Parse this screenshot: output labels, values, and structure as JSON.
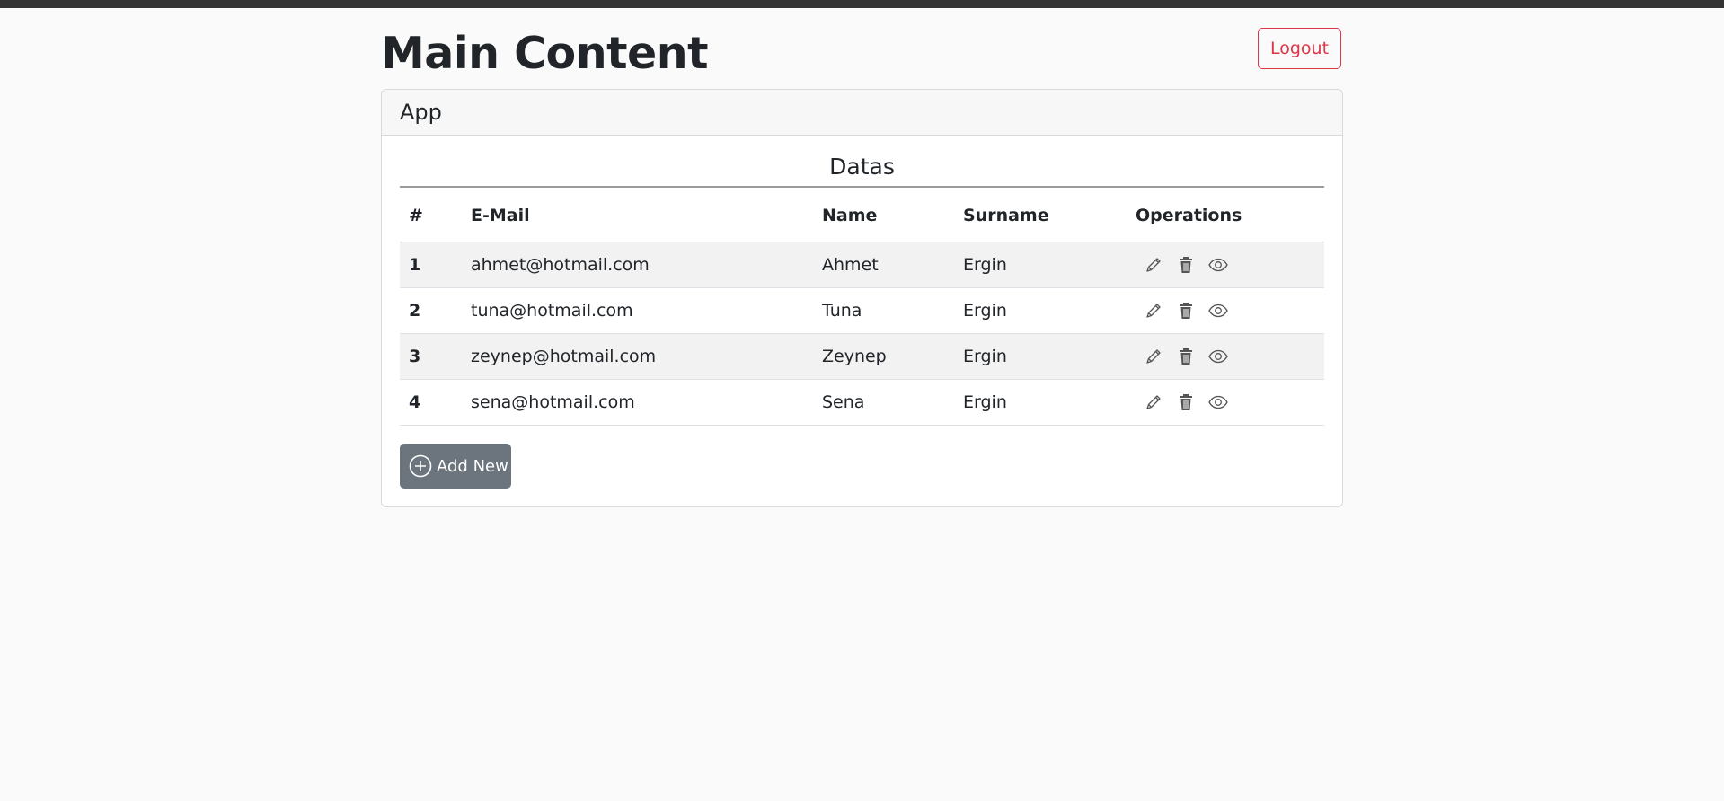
{
  "header": {
    "title": "Main Content",
    "logout_label": "Logout"
  },
  "card": {
    "title": "App",
    "table_caption": "Datas",
    "columns": [
      "#",
      "E-Mail",
      "Name",
      "Surname",
      "Operations"
    ],
    "rows": [
      {
        "id": "1",
        "email": "ahmet@hotmail.com",
        "name": "Ahmet",
        "surname": "Ergin"
      },
      {
        "id": "2",
        "email": "tuna@hotmail.com",
        "name": "Tuna",
        "surname": "Ergin"
      },
      {
        "id": "3",
        "email": "zeynep@hotmail.com",
        "name": "Zeynep",
        "surname": "Ergin"
      },
      {
        "id": "4",
        "email": "sena@hotmail.com",
        "name": "Sena",
        "surname": "Ergin"
      }
    ],
    "row_actions": [
      "pencil-icon",
      "trash-icon",
      "eye-icon"
    ],
    "add_label": "Add New"
  },
  "colors": {
    "danger": "#dc3545",
    "secondary": "#6c757d",
    "topbar": "#343434"
  }
}
